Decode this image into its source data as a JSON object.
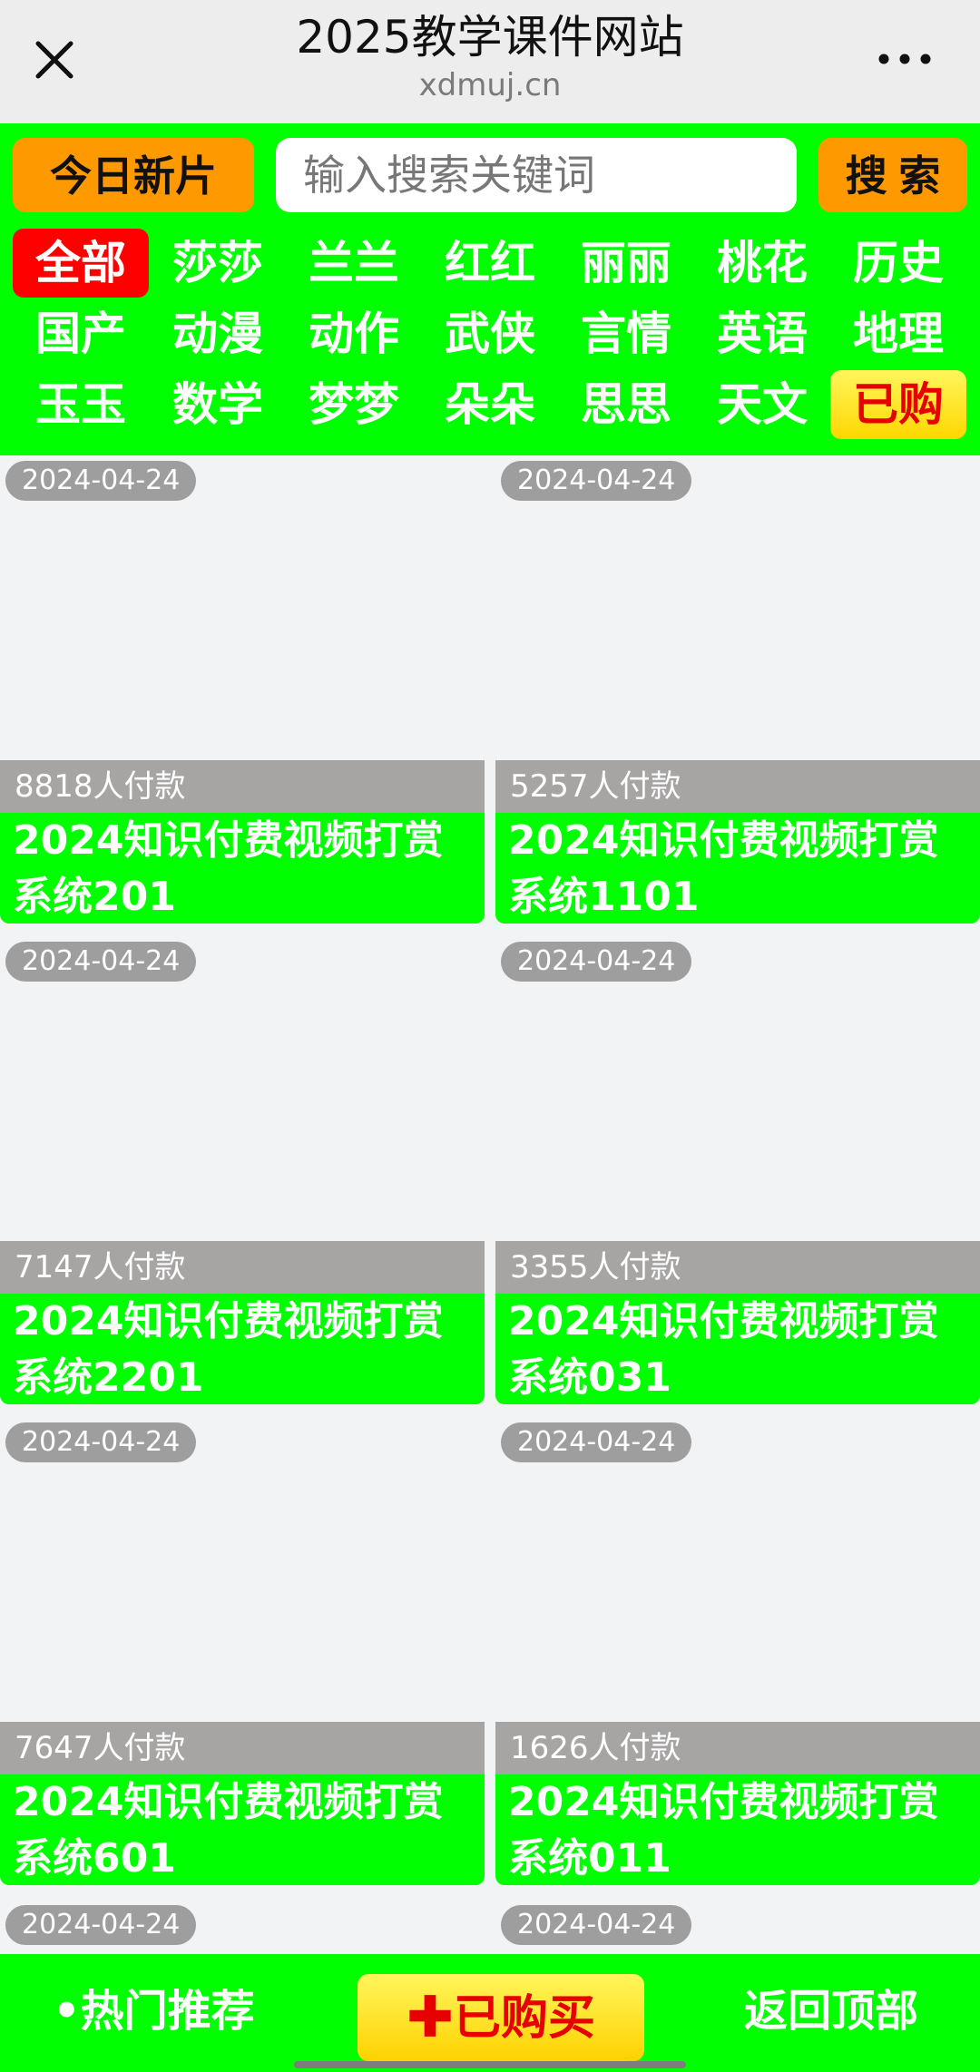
{
  "topbar": {
    "title": "2025教学课件网站",
    "domain": "xdmuj.cn",
    "close_icon": "close-icon",
    "more_icon": "more-icon"
  },
  "header": {
    "today_button": "今日新片",
    "search_placeholder": "输入搜索关键词",
    "search_button": "搜 索",
    "categories": [
      [
        "全部",
        "莎莎",
        "兰兰",
        "红红",
        "丽丽",
        "桃花",
        "历史"
      ],
      [
        "国产",
        "动漫",
        "动作",
        "武侠",
        "言情",
        "英语",
        "地理"
      ],
      [
        "玉玉",
        "数学",
        "梦梦",
        "朵朵",
        "思思",
        "天文",
        "已购"
      ]
    ]
  },
  "cards": [
    {
      "date": "2024-04-24",
      "payers": "8818人付款",
      "title": "2024知识付费视频打赏系统201"
    },
    {
      "date": "2024-04-24",
      "payers": "5257人付款",
      "title": "2024知识付费视频打赏系统1101"
    },
    {
      "date": "2024-04-24",
      "payers": "7147人付款",
      "title": "2024知识付费视频打赏系统2201"
    },
    {
      "date": "2024-04-24",
      "payers": "3355人付款",
      "title": "2024知识付费视频打赏系统031"
    },
    {
      "date": "2024-04-24",
      "payers": "7647人付款",
      "title": "2024知识付费视频打赏系统601"
    },
    {
      "date": "2024-04-24",
      "payers": "1626人付款",
      "title": "2024知识付费视频打赏系统011"
    }
  ],
  "partial_dates": [
    "2024-04-24",
    "2024-04-24"
  ],
  "bottombar": {
    "hot": "•热门推荐",
    "bought": "✚已购买",
    "back_top": "返回顶部"
  },
  "colors": {
    "accent_green": "#00ff00",
    "orange": "#ff9900",
    "active_red": "#ff0000",
    "gold": "#ffd700"
  }
}
